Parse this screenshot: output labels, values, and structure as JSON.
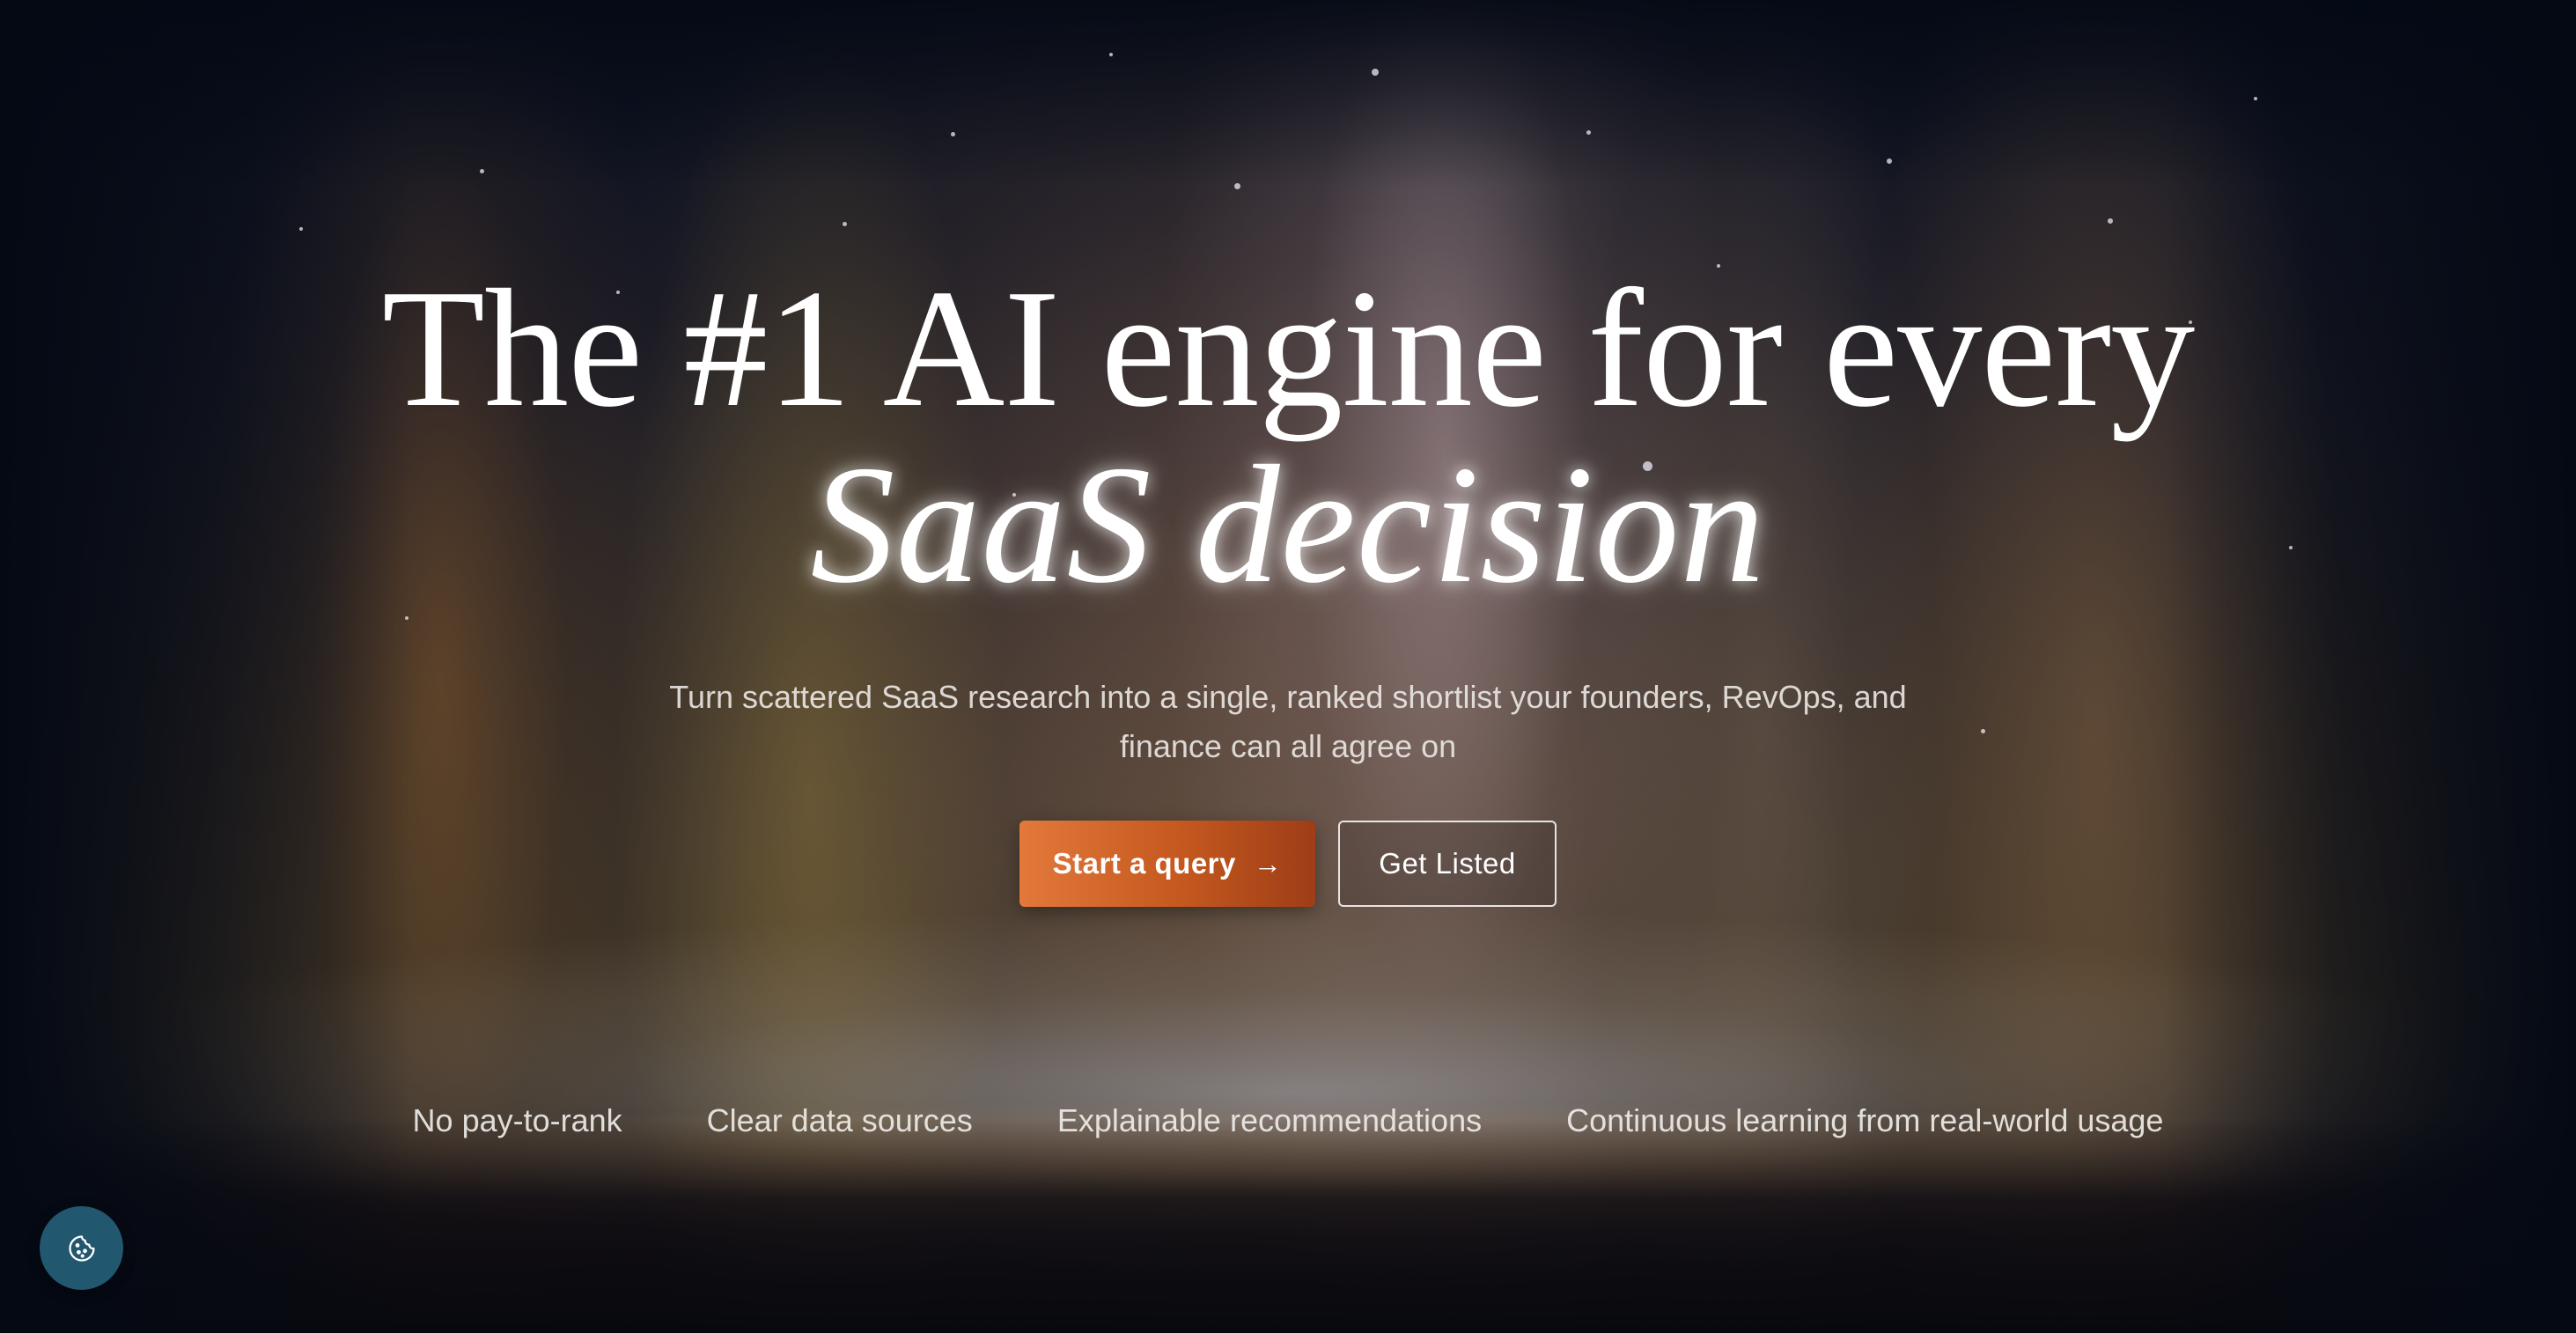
{
  "hero": {
    "headline_line1": "The #1 AI engine for every",
    "headline_line2": "SaaS decision",
    "subtitle": "Turn scattered SaaS research into a single, ranked shortlist your founders, RevOps, and finance can all agree on"
  },
  "cta": {
    "primary_label": "Start a query",
    "primary_icon": "arrow-right-icon",
    "secondary_label": "Get Listed"
  },
  "features": [
    "No pay-to-rank",
    "Clear data sources",
    "Explainable recommendations",
    "Continuous learning from real-world usage"
  ],
  "cookie": {
    "icon": "cookie-icon"
  },
  "colors": {
    "primary_button_start": "#e2793a",
    "primary_button_end": "#9e3d17",
    "cookie_button": "#21586f",
    "background": "#050b18"
  }
}
